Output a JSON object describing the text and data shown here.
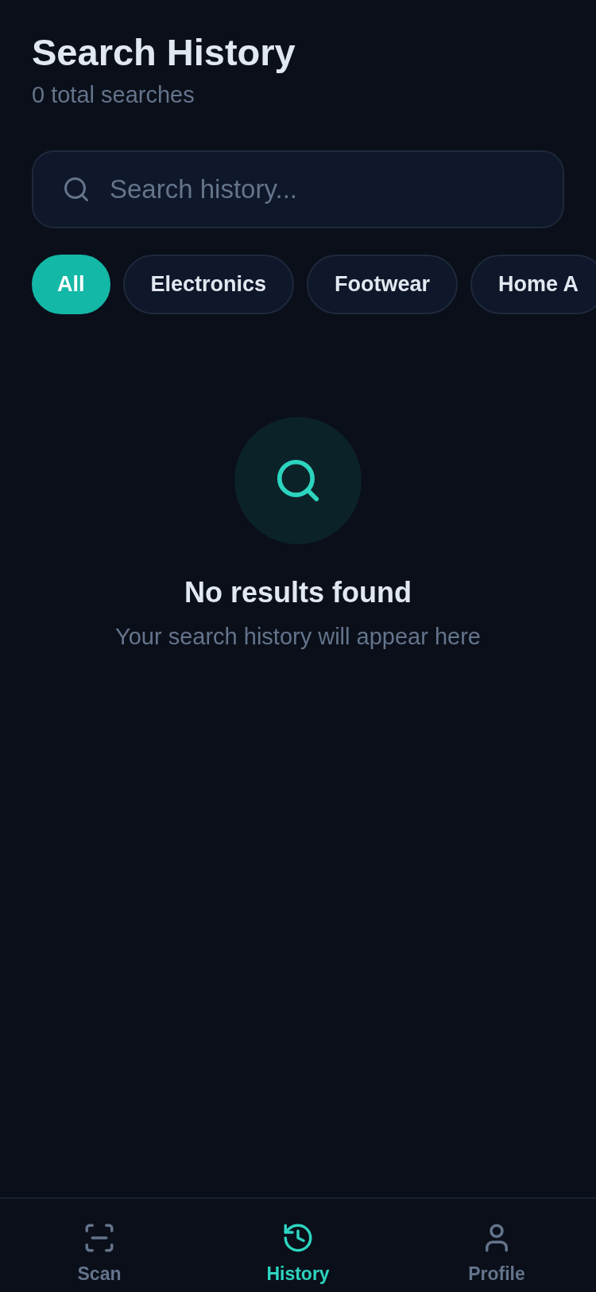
{
  "header": {
    "title": "Search History",
    "subtitle": "0 total searches"
  },
  "search": {
    "placeholder": "Search history..."
  },
  "filters": [
    {
      "label": "All",
      "selected": true
    },
    {
      "label": "Electronics",
      "selected": false
    },
    {
      "label": "Footwear",
      "selected": false
    },
    {
      "label": "Home A",
      "selected": false
    }
  ],
  "empty_state": {
    "title": "No results found",
    "message": "Your search history will appear here"
  },
  "bottom_nav": [
    {
      "label": "Scan",
      "kind": "scan",
      "selected": false
    },
    {
      "label": "History",
      "kind": "history",
      "selected": true
    },
    {
      "label": "Profile",
      "kind": "profile",
      "selected": false
    }
  ]
}
